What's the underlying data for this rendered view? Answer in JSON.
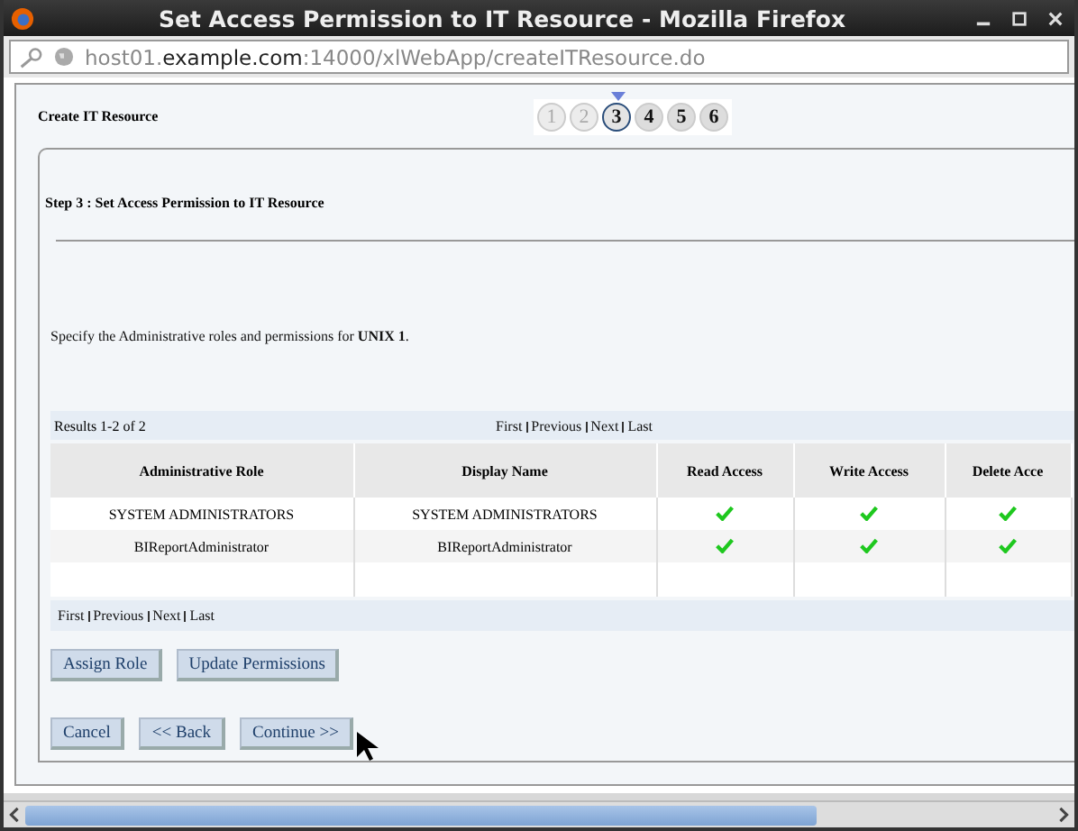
{
  "window": {
    "title": "Set Access Permission to IT Resource - Mozilla Firefox"
  },
  "address_bar": {
    "prefix": "host01.",
    "domain": "example.com",
    "path": ":14000/xlWebApp/createITResource.do"
  },
  "wizard": {
    "title": "Create IT Resource",
    "steps": [
      {
        "label": "1",
        "selected": false,
        "disabled": true
      },
      {
        "label": "2",
        "selected": false,
        "disabled": true
      },
      {
        "label": "3",
        "selected": true,
        "disabled": false
      },
      {
        "label": "4",
        "selected": false,
        "disabled": false
      },
      {
        "label": "5",
        "selected": false,
        "disabled": false
      },
      {
        "label": "6",
        "selected": false,
        "disabled": false
      }
    ]
  },
  "step_heading": "Step 3 :  Set Access Permission to IT Resource",
  "instructions": "Specify the Administrative roles and permissions for **UNIX 1**.",
  "results": "Results 1-2 of 2",
  "top_pager": [
    "First",
    "Previous",
    "Next",
    "Last"
  ],
  "table": {
    "columns": [
      "Administrative Role",
      "Display Name",
      "Read Access",
      "Write Access",
      "Delete Acce"
    ],
    "rows": [
      {
        "role": "SYSTEM ADMINISTRATORS",
        "display_name": "SYSTEM ADMINISTRATORS",
        "read": true,
        "write": true,
        "delete": true
      },
      {
        "role": "BIReportAdministrator",
        "display_name": "BIReportAdministrator",
        "read": true,
        "write": true,
        "delete": true
      }
    ]
  },
  "bottom_pager": [
    "First",
    "Previous",
    "Next",
    "Last"
  ],
  "role_buttons": [
    "Assign Role",
    "Update Permissions"
  ],
  "nav_buttons": [
    "Cancel",
    "<< Back",
    "Continue >>"
  ]
}
